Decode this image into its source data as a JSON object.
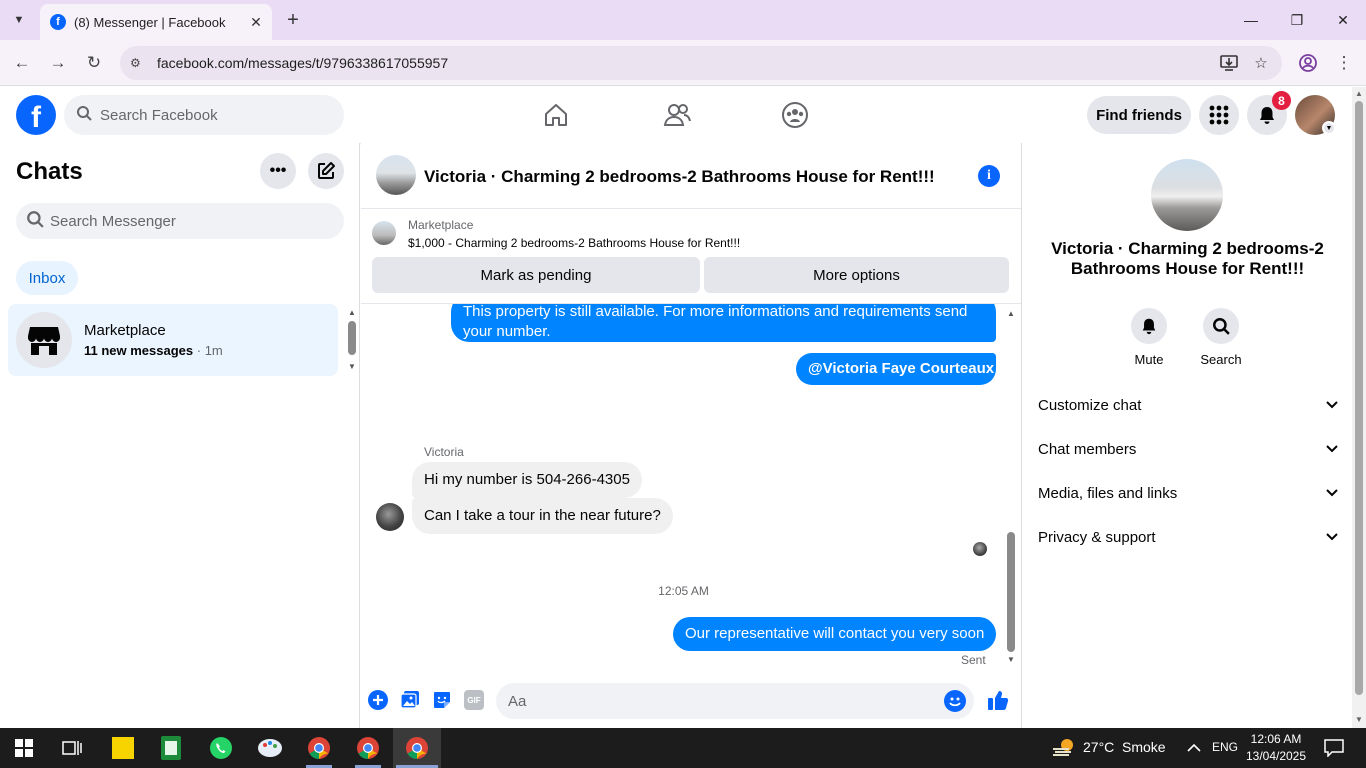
{
  "browser": {
    "tab_title": "(8) Messenger | Facebook",
    "tab_favicon": "f",
    "url": "facebook.com/messages/t/9796338617055957"
  },
  "fb_header": {
    "search_placeholder": "Search Facebook",
    "find_friends": "Find friends",
    "notification_count": "8"
  },
  "chats": {
    "title": "Chats",
    "search_placeholder": "Search Messenger",
    "inbox_label": "Inbox",
    "items": [
      {
        "name": "Marketplace",
        "preview": "11 new messages",
        "time": "· 1m"
      }
    ]
  },
  "conversation": {
    "title": "Victoria · Charming 2 bedrooms-2 Bathrooms House for Rent!!!",
    "marketplace_label": "Marketplace",
    "listing": "$1,000 - Charming 2 bedrooms-2 Bathrooms House for Rent!!!",
    "mark_pending": "Mark as pending",
    "more_options": "More options",
    "messages": {
      "out1": "This property is still available. For more informations and requirements send your number.",
      "out2": "@Victoria Faye Courteaux",
      "sender": "Victoria",
      "in1": "Hi my number is 504-266-4305",
      "in2": "Can I take a tour in the near future?",
      "timestamp": "12:05 AM",
      "out3": "Our representative will contact you very soon",
      "status": "Sent"
    },
    "composer_placeholder": "Aa",
    "gif_label": "GIF"
  },
  "info_panel": {
    "title": "Victoria · Charming 2 bedrooms-2 Bathrooms House for Rent!!!",
    "mute": "Mute",
    "search": "Search",
    "sections": [
      "Customize chat",
      "Chat members",
      "Media, files and links",
      "Privacy & support"
    ]
  },
  "taskbar": {
    "weather_temp": "27°C",
    "weather_cond": "Smoke",
    "lang": "ENG",
    "time": "12:06 AM",
    "date": "13/04/2025"
  },
  "colors": {
    "fb_blue": "#0866ff",
    "message_blue": "#0084ff",
    "badge_red": "#e41e3f"
  }
}
